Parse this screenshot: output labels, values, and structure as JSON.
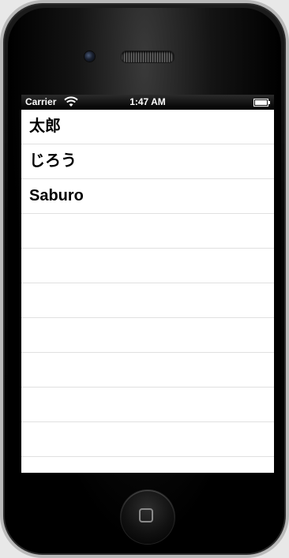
{
  "status_bar": {
    "carrier": "Carrier",
    "time": "1:47 AM",
    "wifi_icon": "wifi-icon",
    "battery_icon": "battery-icon"
  },
  "table": {
    "rows": [
      {
        "label": "太郎"
      },
      {
        "label": "じろう"
      },
      {
        "label": "Saburo"
      },
      {
        "label": ""
      },
      {
        "label": ""
      },
      {
        "label": ""
      },
      {
        "label": ""
      },
      {
        "label": ""
      },
      {
        "label": ""
      },
      {
        "label": ""
      }
    ]
  },
  "device": {
    "camera_icon": "camera-icon",
    "speaker_icon": "speaker-grille-icon",
    "home_icon": "home-button-icon"
  }
}
